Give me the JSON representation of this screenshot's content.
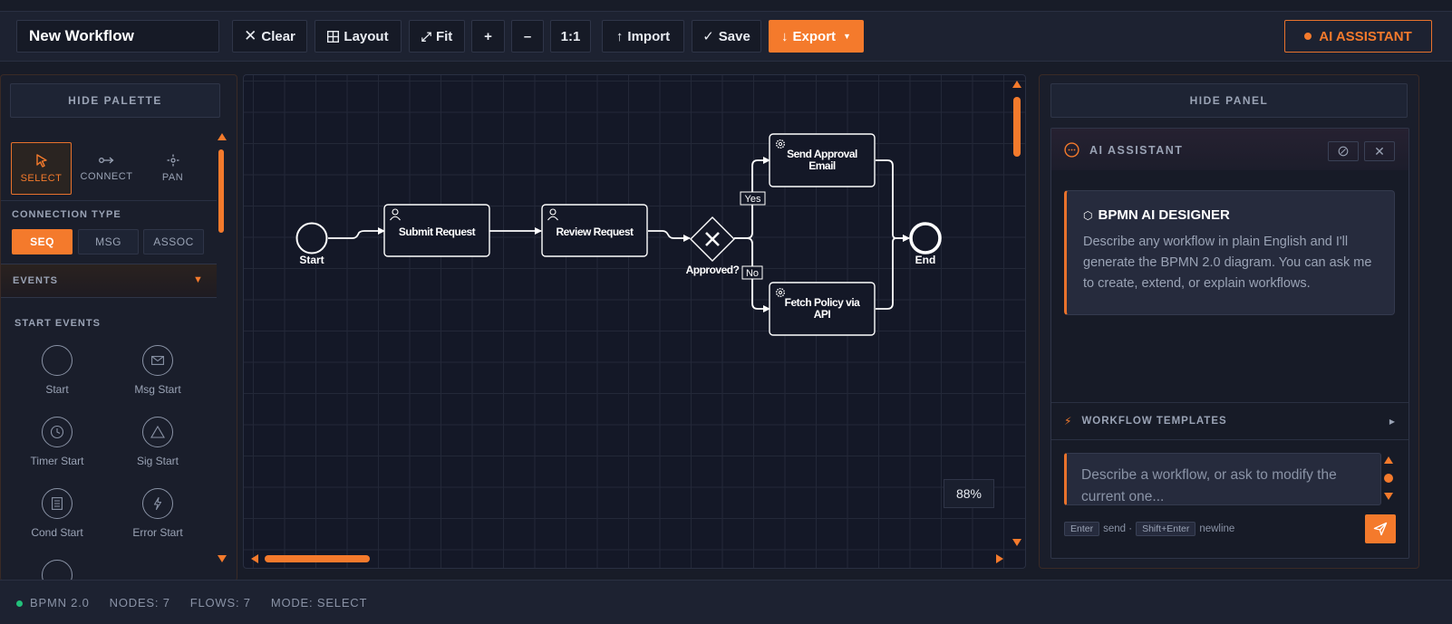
{
  "toolbar": {
    "workflow_name": "New Workflow",
    "clear": "Clear",
    "layout": "Layout",
    "fit": "Fit",
    "zoom_in": "+",
    "zoom_out": "–",
    "actual_size": "1:1",
    "import": "Import",
    "save": "Save",
    "export": "Export",
    "ai_assistant": "AI ASSISTANT"
  },
  "palette": {
    "hide_label": "HIDE PALETTE",
    "tools": [
      {
        "label": "SELECT",
        "icon": "cursor-icon",
        "active": true
      },
      {
        "label": "CONNECT",
        "icon": "connect-icon",
        "active": false
      },
      {
        "label": "PAN",
        "icon": "pan-icon",
        "active": false
      }
    ],
    "connection_type_label": "CONNECTION TYPE",
    "connection_types": [
      {
        "label": "SEQ",
        "active": true
      },
      {
        "label": "MSG",
        "active": false
      },
      {
        "label": "ASSOC",
        "active": false
      }
    ],
    "events_label": "EVENTS",
    "start_events_label": "START EVENTS",
    "start_events": [
      {
        "label": "Start",
        "icon": "circle-icon"
      },
      {
        "label": "Msg Start",
        "icon": "envelope-icon"
      },
      {
        "label": "Timer Start",
        "icon": "clock-icon"
      },
      {
        "label": "Sig Start",
        "icon": "triangle-icon"
      },
      {
        "label": "Cond Start",
        "icon": "document-icon"
      },
      {
        "label": "Error Start",
        "icon": "lightning-icon"
      }
    ]
  },
  "diagram": {
    "nodes": {
      "start": "Start",
      "submit": "Submit Request",
      "review": "Review Request",
      "gateway": "Approved?",
      "email": "Send Approval Email",
      "policy": "Fetch Policy via API",
      "end": "End"
    },
    "flows": {
      "yes": "Yes",
      "no": "No"
    },
    "zoom": "88%"
  },
  "panel": {
    "hide_label": "HIDE PANEL",
    "header_title": "AI ASSISTANT",
    "message_title": "BPMN AI DESIGNER",
    "message_body": "Describe any workflow in plain English and I'll generate the BPMN 2.0 diagram. You can ask me to create, extend, or explain workflows.",
    "templates_label": "WORKFLOW TEMPLATES",
    "input_placeholder": "Describe a workflow, or ask to modify the current one...",
    "hint_enter": "Enter",
    "hint_send": "send ·",
    "hint_shift": "Shift+Enter",
    "hint_newline": "newline"
  },
  "status": {
    "version": "BPMN 2.0",
    "nodes": "NODES: 7",
    "flows": "FLOWS: 7",
    "mode": "MODE: SELECT"
  },
  "colors": {
    "accent": "#f47a2c",
    "background": "#181c28",
    "canvas": "#141827",
    "status_ok": "#22c07a"
  }
}
